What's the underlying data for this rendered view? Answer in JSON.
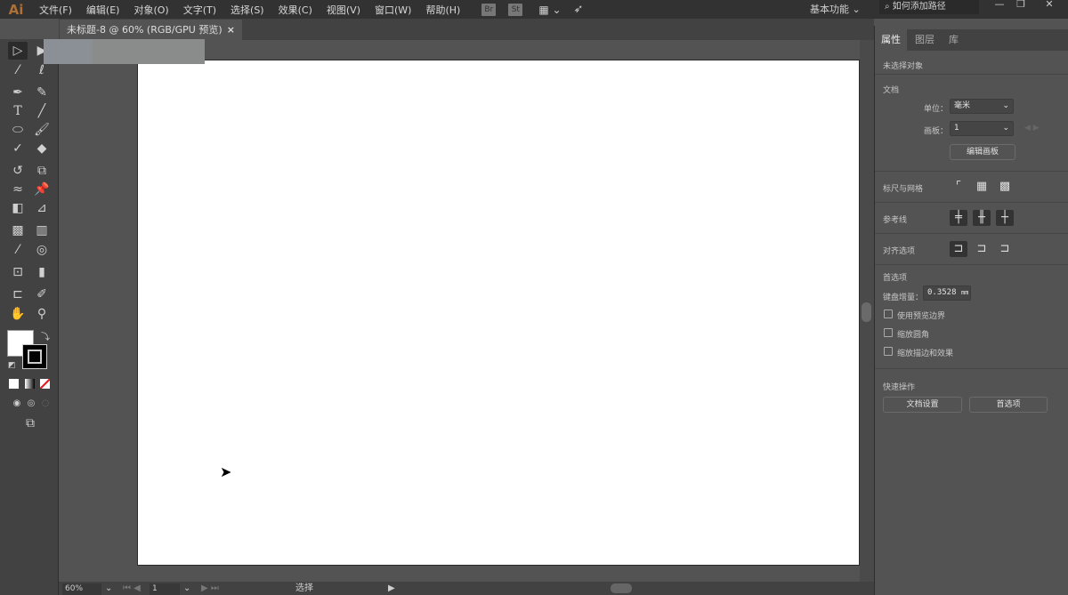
{
  "app": {
    "logo": "Ai"
  },
  "menu": [
    "文件(F)",
    "编辑(E)",
    "对象(O)",
    "文字(T)",
    "选择(S)",
    "效果(C)",
    "视图(V)",
    "窗口(W)",
    "帮助(H)"
  ],
  "app_icons": [
    "Br",
    "St"
  ],
  "workspace": "基本功能",
  "search_placeholder": "如何添加路径",
  "document_tab": {
    "title": "未标题-8 @ 60% (RGB/GPU 预览)",
    "close": "×"
  },
  "status": {
    "zoom": "60%",
    "artboard": "1",
    "tool": "选择"
  },
  "panel": {
    "tabs": [
      "属性",
      "图层",
      "库"
    ],
    "no_selection": "未选择对象",
    "document": "文档",
    "unit_label": "单位：",
    "unit_value": "毫米",
    "artboard_label": "画板：",
    "artboard_value": "1",
    "edit_artboards": "编辑画板",
    "rulers_grids": "标尺与网格",
    "guides": "参考线",
    "snap_options": "对齐选项",
    "preferences": "首选项",
    "keyboard_increment_label": "键盘增量：",
    "keyboard_increment_value": "0.3528",
    "keyboard_increment_unit": "mm",
    "checkboxes": [
      {
        "label": "使用预览边界",
        "checked": false
      },
      {
        "label": "缩放圆角",
        "checked": false
      },
      {
        "label": "缩放描边和效果",
        "checked": false
      }
    ],
    "quick_actions": "快速操作",
    "document_setup": "文档设置",
    "preferences_button": "首选项"
  }
}
